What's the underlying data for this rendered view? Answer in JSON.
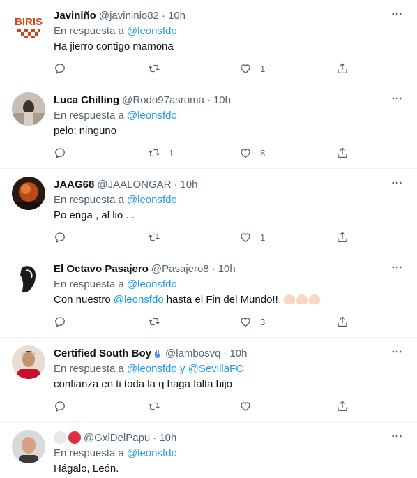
{
  "reply_prefix": "En respuesta a",
  "tweets": [
    {
      "name": "Javiniño",
      "handle": "@javininio82",
      "time": "10h",
      "mention": "@leonsfdo",
      "text": "Ha jierro contigo mamona",
      "replies": "",
      "retweets": "",
      "likes": "1",
      "avatar_text": "BIRIS"
    },
    {
      "name": "Luca Chilling",
      "handle": "@Rodo97asroma",
      "time": "10h",
      "mention": "@leonsfdo",
      "text": "pelo: ninguno",
      "replies": "",
      "retweets": "1",
      "likes": "8"
    },
    {
      "name": "JAAG68",
      "handle": "@JAALONGAR",
      "time": "10h",
      "mention": "@leonsfdo",
      "text": "Po enga , al lio ...",
      "replies": "",
      "retweets": "",
      "likes": "1"
    },
    {
      "name": "El Octavo Pasajero",
      "handle": "@Pasajero8",
      "time": "10h",
      "mention": "@leonsfdo",
      "text_before": "Con nuestro",
      "text_mention": "@leonsfdo",
      "text_after": "hasta el Fin del Mundo!!",
      "replies": "",
      "retweets": "",
      "likes": "3"
    },
    {
      "name": "Certified South Boy",
      "handle": "@lambosvq",
      "time": "10h",
      "mention": "@leonsfdo y @SevillaFC",
      "text": "confianza en ti toda la q haga falta hijo",
      "replies": "",
      "retweets": "",
      "likes": ""
    },
    {
      "name": "",
      "handle": "@GxlDelPapu",
      "time": "10h",
      "mention": "@leonsfdo",
      "text": "Hágalo, León.",
      "replies": "",
      "retweets": "",
      "likes": ""
    }
  ],
  "colors": {
    "accent": "#1d9bf0",
    "muted": "#536471",
    "text": "#0f1419",
    "divider": "#eff3f4"
  },
  "icons": [
    "reply-icon",
    "retweet-icon",
    "like-icon",
    "share-icon",
    "more-icon"
  ]
}
